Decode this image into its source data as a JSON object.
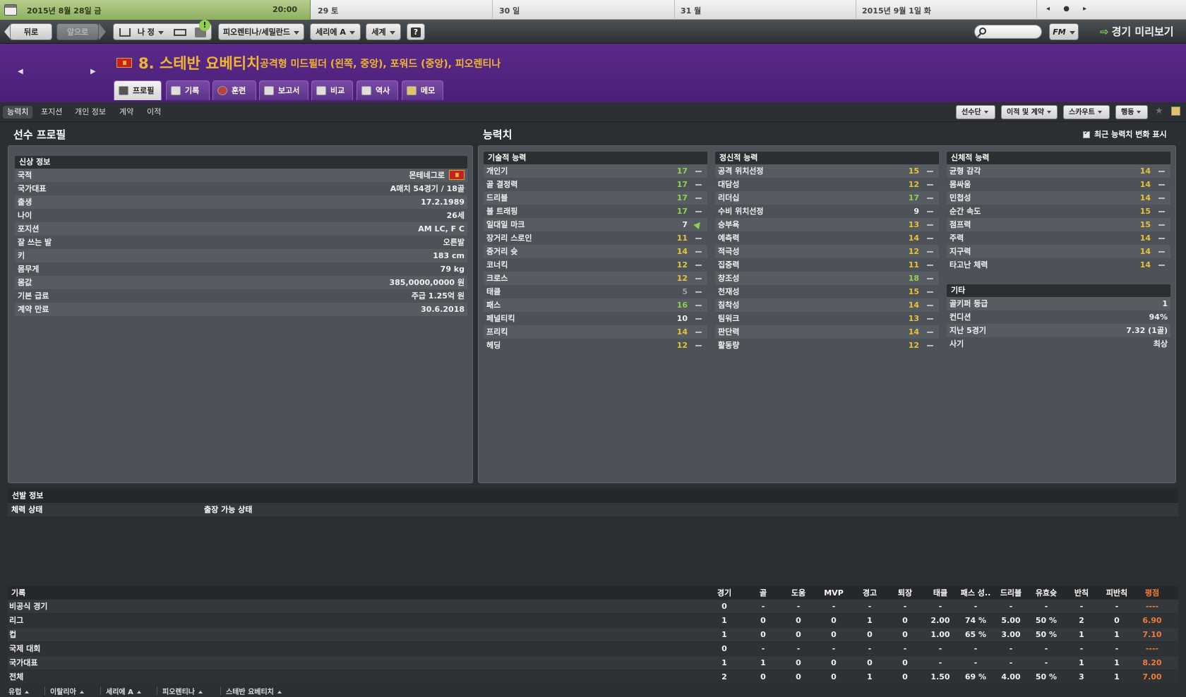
{
  "datebar": {
    "today": "2015년 8월 28일 금",
    "time": "20:00",
    "days": [
      "29 토",
      "30 일",
      "31 월",
      "2015년 9월 1일 화"
    ],
    "nav_symbols": "◂ ● ▸"
  },
  "toolbar": {
    "back": "뒤로",
    "forward": "앞으로",
    "my_team": "나 정",
    "club": "피오렌티나/세밀란드",
    "league": "세리에 A",
    "world": "세계",
    "help": "?",
    "search_placeholder": "",
    "fm": "FM",
    "match_preview": "경기 미리보기"
  },
  "player": {
    "name": "8. 스테반 요베티치",
    "positions": "공격형 미드필더 (왼쪽, 중앙), 포워드 (중앙), 피오렌티나",
    "tabs": [
      "프로필",
      "기록",
      "훈련",
      "보고서",
      "비교",
      "역사",
      "메모"
    ]
  },
  "subnav": {
    "tabs": [
      "능력치",
      "포지션",
      "개인 정보",
      "계약",
      "이적"
    ],
    "buttons": [
      "선수단",
      "이적 및 계약",
      "스카우트",
      "행동"
    ]
  },
  "profile": {
    "section_title": "선수 프로필",
    "bio_title": "신상 정보",
    "rows": [
      {
        "label": "국적",
        "value": "몬테네그로"
      },
      {
        "label": "국가대표",
        "value": "A매치 54경기 / 18골"
      },
      {
        "label": "출생",
        "value": "17.2.1989"
      },
      {
        "label": "나이",
        "value": "26세"
      },
      {
        "label": "포지션",
        "value": "AM LC, F C"
      },
      {
        "label": "잘 쓰는 발",
        "value": "오른발"
      },
      {
        "label": "키",
        "value": "183 cm"
      },
      {
        "label": "몸무게",
        "value": "79 kg"
      },
      {
        "label": "몸값",
        "value": "385,0000,0000 원"
      },
      {
        "label": "기본 급료",
        "value": "주급 1.25억 원"
      },
      {
        "label": "계약 만료",
        "value": "30.6.2018"
      }
    ]
  },
  "attributes": {
    "section_title": "능력치",
    "recent_changes_label": "최근 능력치 변화 표시",
    "technical": {
      "title": "기술적 능력",
      "items": [
        {
          "name": "개인기",
          "value": 17,
          "trend": "flat"
        },
        {
          "name": "골 결정력",
          "value": 17,
          "trend": "flat"
        },
        {
          "name": "드리블",
          "value": 17,
          "trend": "flat"
        },
        {
          "name": "볼 트래핑",
          "value": 17,
          "trend": "flat"
        },
        {
          "name": "일대일 마크",
          "value": 7,
          "trend": "up"
        },
        {
          "name": "장거리 스로인",
          "value": 11,
          "trend": "flat"
        },
        {
          "name": "중거리 슛",
          "value": 14,
          "trend": "flat"
        },
        {
          "name": "코너킥",
          "value": 12,
          "trend": "flat"
        },
        {
          "name": "크로스",
          "value": 12,
          "trend": "flat"
        },
        {
          "name": "태클",
          "value": 5,
          "trend": "flat"
        },
        {
          "name": "패스",
          "value": 16,
          "trend": "flat"
        },
        {
          "name": "페널티킥",
          "value": 10,
          "trend": "flat"
        },
        {
          "name": "프리킥",
          "value": 14,
          "trend": "flat"
        },
        {
          "name": "헤딩",
          "value": 12,
          "trend": "flat"
        }
      ]
    },
    "mental": {
      "title": "정신적 능력",
      "items": [
        {
          "name": "공격 위치선정",
          "value": 15,
          "trend": "flat"
        },
        {
          "name": "대담성",
          "value": 12,
          "trend": "flat"
        },
        {
          "name": "리더십",
          "value": 17,
          "trend": "flat"
        },
        {
          "name": "수비 위치선정",
          "value": 9,
          "trend": "flat"
        },
        {
          "name": "승부욕",
          "value": 13,
          "trend": "flat"
        },
        {
          "name": "예측력",
          "value": 14,
          "trend": "flat"
        },
        {
          "name": "적극성",
          "value": 12,
          "trend": "flat"
        },
        {
          "name": "집중력",
          "value": 11,
          "trend": "flat"
        },
        {
          "name": "창조성",
          "value": 18,
          "trend": "flat"
        },
        {
          "name": "천재성",
          "value": 15,
          "trend": "flat"
        },
        {
          "name": "침착성",
          "value": 14,
          "trend": "flat"
        },
        {
          "name": "팀워크",
          "value": 13,
          "trend": "flat"
        },
        {
          "name": "판단력",
          "value": 14,
          "trend": "flat"
        },
        {
          "name": "활동량",
          "value": 12,
          "trend": "flat"
        }
      ]
    },
    "physical": {
      "title": "신체적 능력",
      "items": [
        {
          "name": "균형 감각",
          "value": 14,
          "trend": "flat"
        },
        {
          "name": "몸싸움",
          "value": 14,
          "trend": "flat"
        },
        {
          "name": "민첩성",
          "value": 14,
          "trend": "flat"
        },
        {
          "name": "순간 속도",
          "value": 15,
          "trend": "flat"
        },
        {
          "name": "점프력",
          "value": 15,
          "trend": "flat"
        },
        {
          "name": "주력",
          "value": 14,
          "trend": "flat"
        },
        {
          "name": "지구력",
          "value": 14,
          "trend": "flat"
        },
        {
          "name": "타고난 체력",
          "value": 14,
          "trend": "flat"
        }
      ]
    },
    "other": {
      "title": "기타",
      "items": [
        {
          "name": "골키퍼 등급",
          "value": "1"
        },
        {
          "name": "컨디션",
          "value": "94%"
        },
        {
          "name": "지난 5경기",
          "value": "7.32 (1골)"
        },
        {
          "name": "사기",
          "value": "최상"
        }
      ]
    }
  },
  "selection": {
    "title": "선발 정보",
    "fitness_label": "체력 상태",
    "availability_label": "출장 가능 상태"
  },
  "stats": {
    "title": "기록",
    "columns": [
      "경기",
      "골",
      "도움",
      "MVP",
      "경고",
      "퇴장",
      "태클",
      "패스 성..",
      "드리블",
      "유효슛",
      "반칙",
      "피반칙",
      "평점"
    ],
    "rows": [
      {
        "label": "비공식 경기",
        "values": [
          "0",
          "-",
          "-",
          "-",
          "-",
          "-",
          "-",
          "-",
          "-",
          "-",
          "-",
          "-",
          "----"
        ]
      },
      {
        "label": "리그",
        "values": [
          "1",
          "0",
          "0",
          "0",
          "1",
          "0",
          "2.00",
          "74 %",
          "5.00",
          "50 %",
          "2",
          "0",
          "6.90"
        ]
      },
      {
        "label": "컵",
        "values": [
          "1",
          "0",
          "0",
          "0",
          "0",
          "0",
          "1.00",
          "65 %",
          "3.00",
          "50 %",
          "1",
          "1",
          "7.10"
        ]
      },
      {
        "label": "국제 대회",
        "values": [
          "0",
          "-",
          "-",
          "-",
          "-",
          "-",
          "-",
          "-",
          "-",
          "-",
          "-",
          "-",
          "----"
        ]
      },
      {
        "label": "국가대표",
        "values": [
          "1",
          "1",
          "0",
          "0",
          "0",
          "0",
          "-",
          "-",
          "-",
          "-",
          "1",
          "1",
          "8.20"
        ]
      },
      {
        "label": "전체",
        "values": [
          "2",
          "0",
          "0",
          "0",
          "1",
          "0",
          "1.50",
          "69 %",
          "4.00",
          "50 %",
          "3",
          "1",
          "7.00"
        ]
      }
    ]
  },
  "breadcrumbs": [
    "유럽",
    "이탈리아",
    "세리에 A",
    "피오렌티나",
    "스테반 요베티치"
  ]
}
